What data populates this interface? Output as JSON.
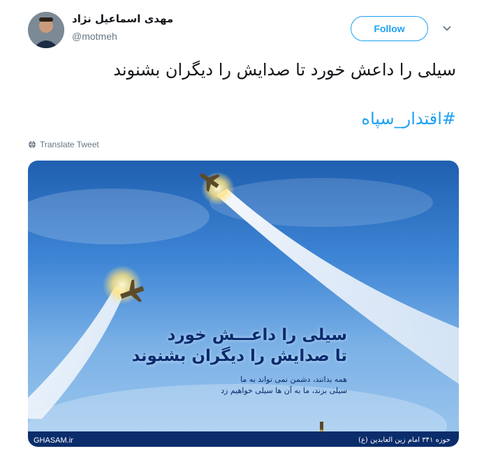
{
  "user": {
    "display_name": "مهدی اسماعیل نژاد",
    "handle": "@motmeh"
  },
  "actions": {
    "follow_label": "Follow",
    "translate_label": "Translate Tweet"
  },
  "tweet": {
    "text": "سیلی را داعش خورد تا صدایش را دیگران بشنوند",
    "hashtag": "#اقتدار_سپاه"
  },
  "media": {
    "title_line1": "سیلی را داعـــش خورد",
    "title_line2": "تا صدایش را دیگران بشنوند",
    "sub_line1": "همه بدانند، دشمن نمی تواند به ما",
    "sub_line2": "سیلی بزند، ما به آن ها سیلی خواهیم زد",
    "site_label": "GHASAM.ir",
    "org_label": "حوزه ۳۴۱ امام زین العابدین (ع)"
  },
  "colors": {
    "accent": "#1da1f2",
    "text": "#14171a",
    "muted": "#657786"
  }
}
